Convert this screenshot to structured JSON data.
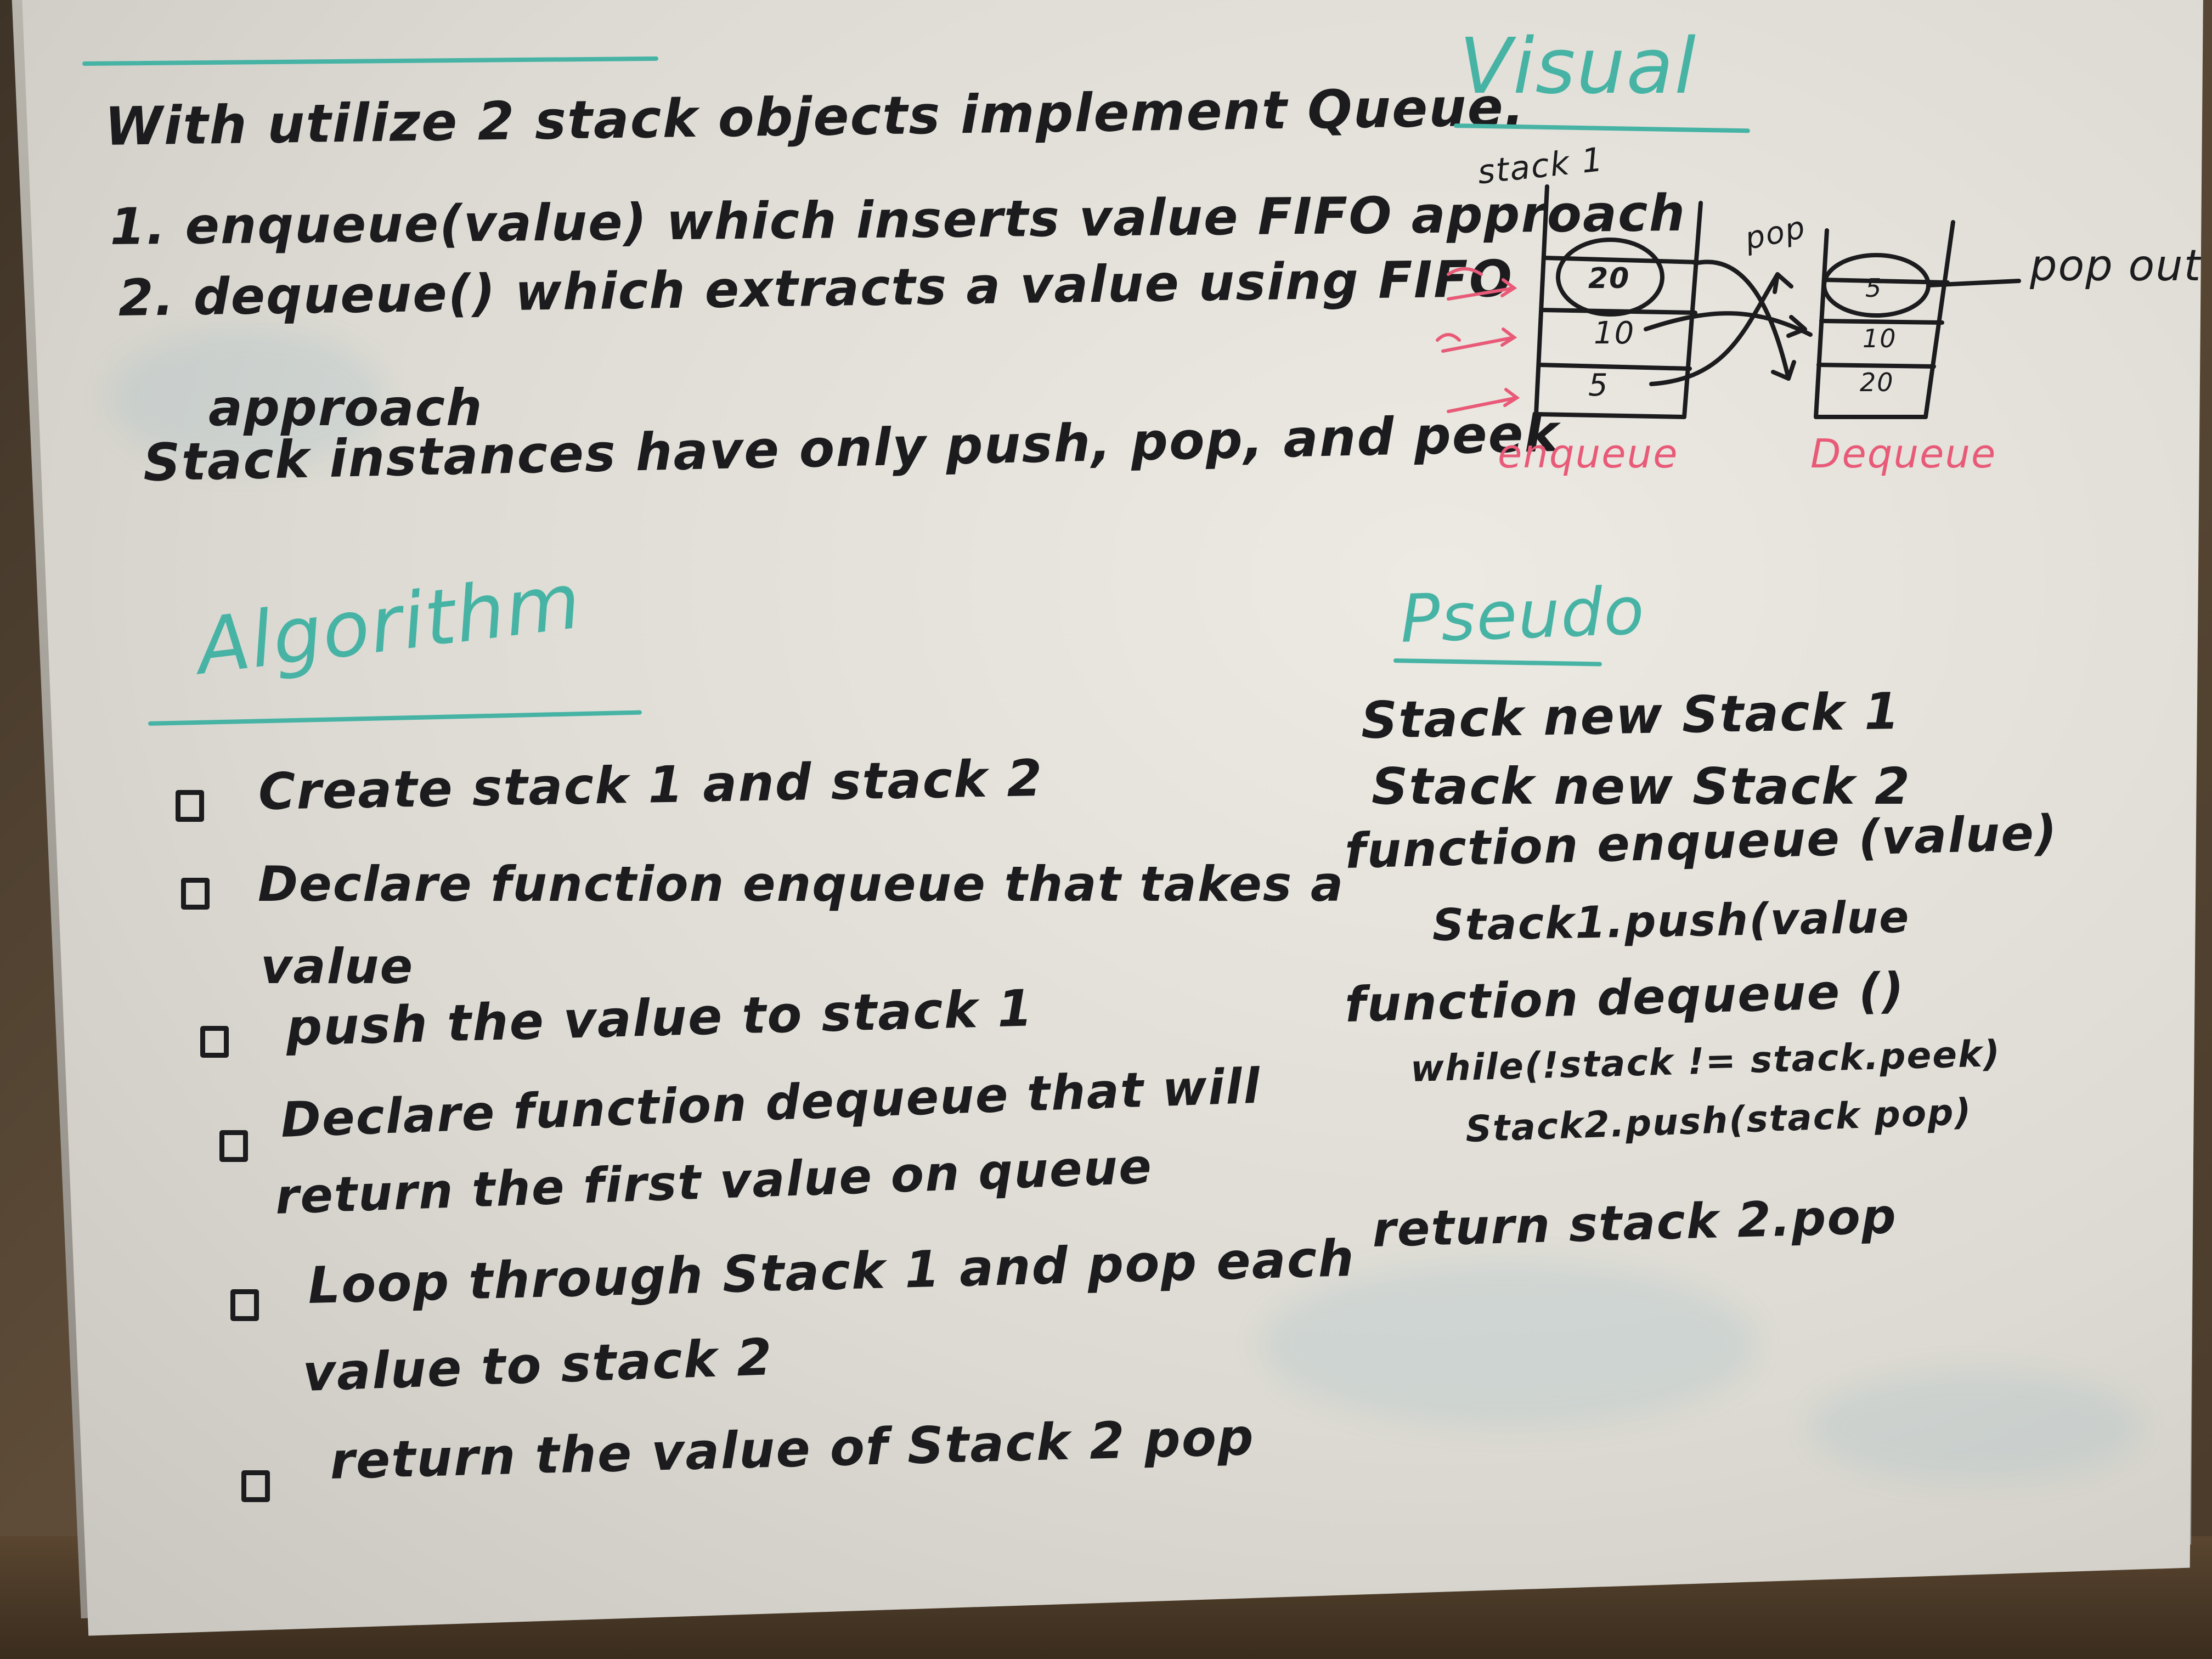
{
  "problem": {
    "statement": "With utilize 2 stack objects implement Queue.",
    "item1": "1. enqueue(value) which inserts value FIFO approach",
    "item2": "2. dequeue() which extracts a value using FIFO",
    "item2_cont": "approach",
    "note": "Stack instances have only push, pop, and peek"
  },
  "visual": {
    "heading": "Visual",
    "stack_label": "stack 1",
    "stack1_values": [
      "20",
      "10",
      "5"
    ],
    "stack2_values": [
      "5",
      "10",
      "20"
    ],
    "pop_label": "pop",
    "pop_out_label": "pop out",
    "enqueue_label": "enqueue",
    "dequeue_label": "Dequeue"
  },
  "algorithm": {
    "heading": "Algorithm",
    "steps": [
      "Create stack 1 and stack 2",
      "Declare function enqueue that takes a",
      "value",
      "push the value to stack 1",
      "Declare function dequeue that will",
      "return the first value on queue",
      "Loop through Stack 1 and pop each",
      "value to stack 2",
      "return the value of Stack 2 pop"
    ]
  },
  "pseudo": {
    "heading": "Pseudo",
    "lines": [
      "Stack new Stack 1",
      "Stack new Stack 2",
      "function enqueue (value)",
      "Stack1.push(value",
      "function dequeue ()",
      "while(!stack != stack.peek)",
      "Stack2.push(stack pop)",
      "return stack 2.pop"
    ]
  },
  "colors": {
    "marker_black": "#1c1c1f",
    "marker_teal": "#46b3a5",
    "marker_pink": "#e85a78"
  }
}
